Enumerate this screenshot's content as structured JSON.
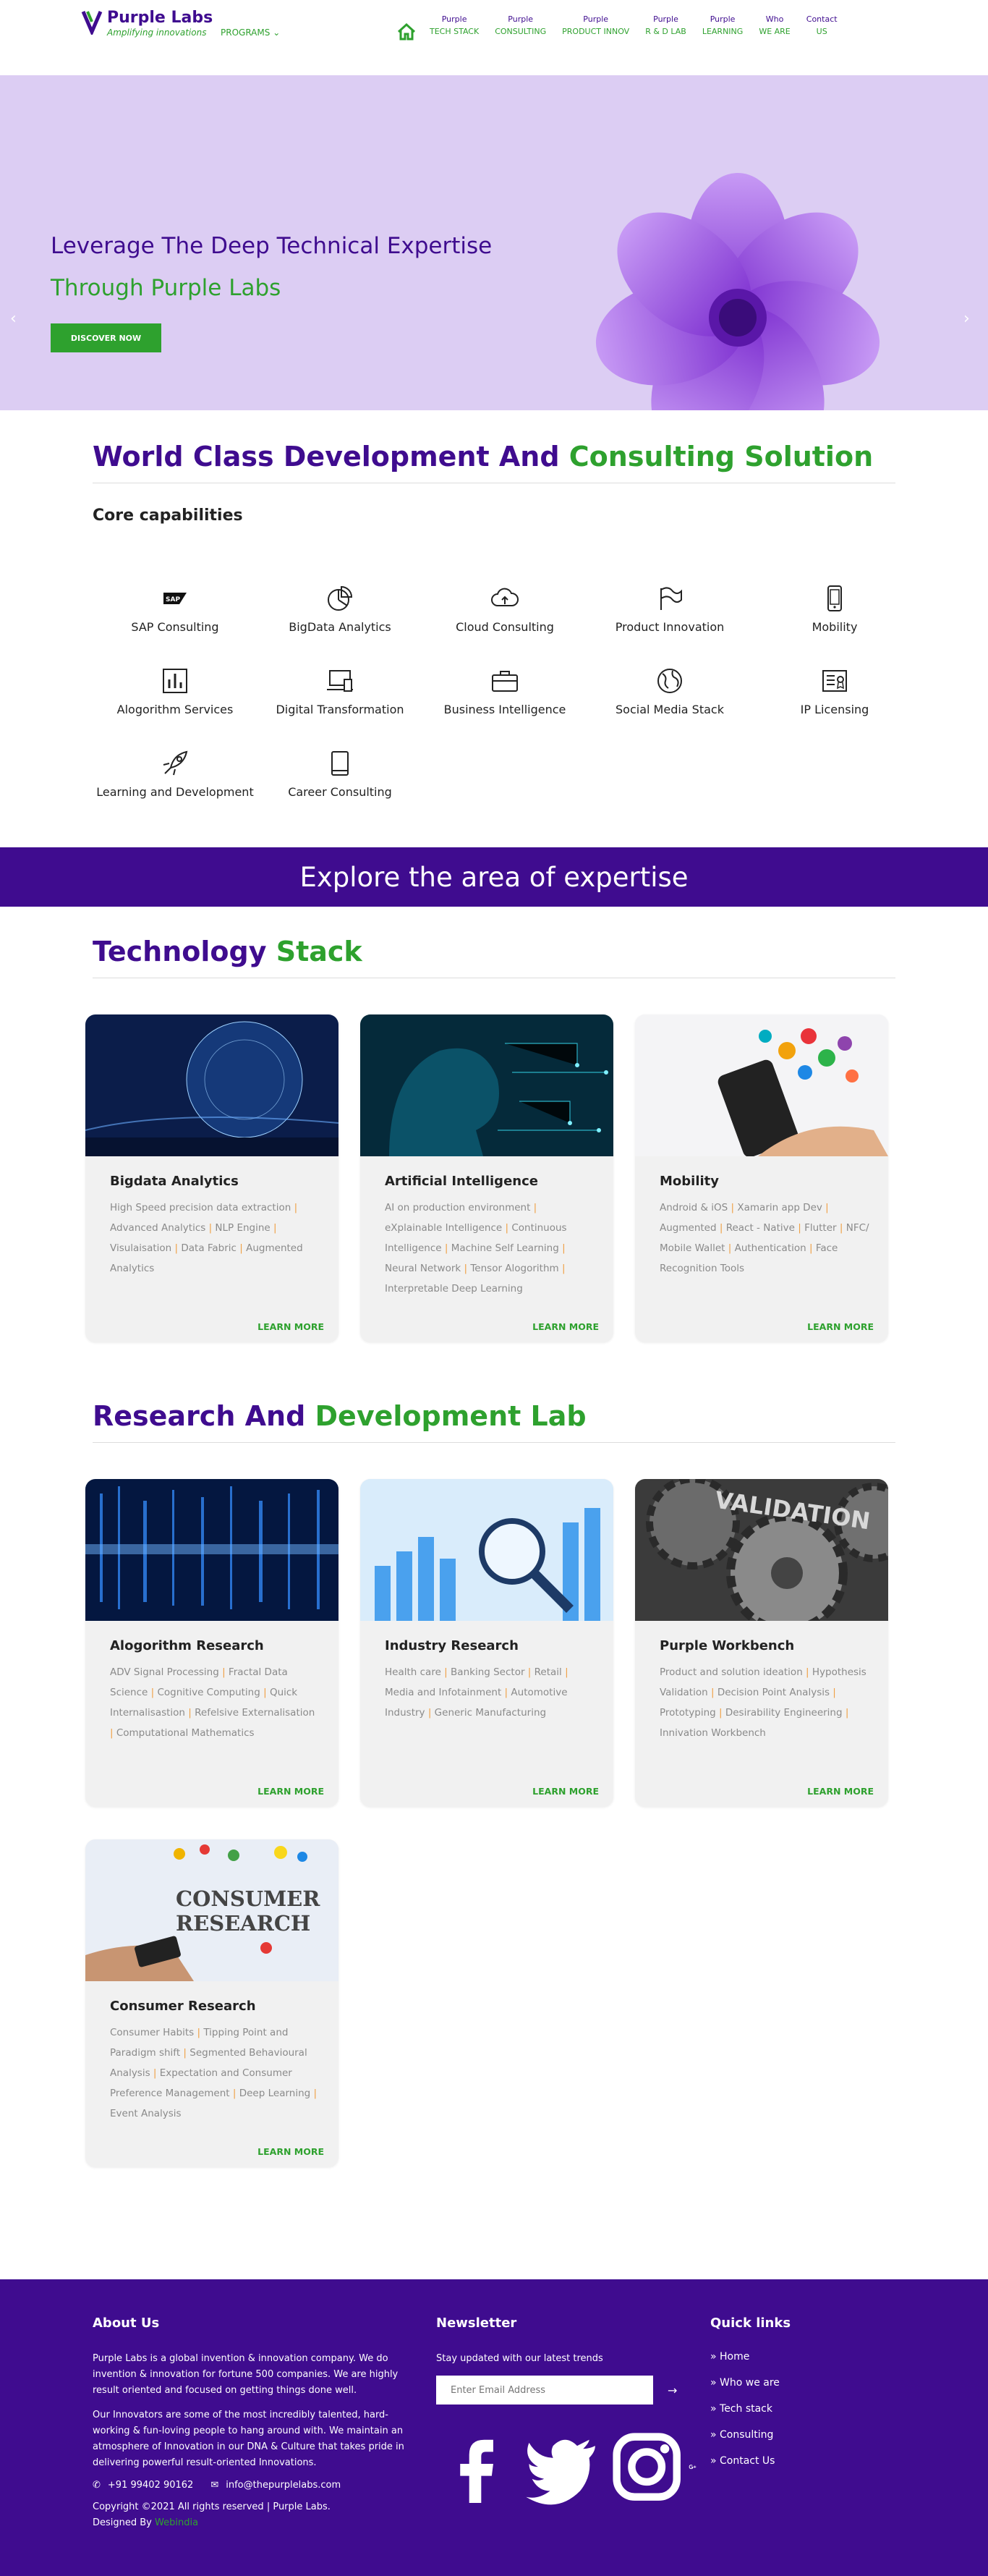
{
  "brand": {
    "name": "Purple Labs",
    "tagline": "Amplifying innovations"
  },
  "programs_label": "PROGRAMS",
  "nav": [
    {
      "top": "Purple",
      "bottom": "TECH STACK"
    },
    {
      "top": "Purple",
      "bottom": "CONSULTING"
    },
    {
      "top": "Purple",
      "bottom": "PRODUCT INNOV"
    },
    {
      "top": "Purple",
      "bottom": "R & D LAB"
    },
    {
      "top": "Purple",
      "bottom": "LEARNING"
    },
    {
      "top": "Who",
      "bottom": "WE ARE"
    },
    {
      "top": "Contact",
      "bottom": "US"
    }
  ],
  "hero": {
    "line1": "Leverage The Deep Technical Expertise",
    "line2": "Through Purple Labs",
    "button": "DISCOVER NOW"
  },
  "world": {
    "title_a": "World Class Development And",
    "title_b": "Consulting Solution",
    "core": "Core capabilities",
    "capabilities": [
      {
        "label": "SAP Consulting",
        "icon": "sap-icon"
      },
      {
        "label": "BigData Analytics",
        "icon": "pie-chart-icon"
      },
      {
        "label": "Cloud Consulting",
        "icon": "cloud-icon"
      },
      {
        "label": "Product Innovation",
        "icon": "flag-icon"
      },
      {
        "label": "Mobility",
        "icon": "mobile-icon"
      },
      {
        "label": "Alogorithm Services",
        "icon": "bar-chart-icon"
      },
      {
        "label": "Digital Transformation",
        "icon": "devices-icon"
      },
      {
        "label": "Business Intelligence",
        "icon": "briefcase-icon"
      },
      {
        "label": "Social Media Stack",
        "icon": "globe-icon"
      },
      {
        "label": "IP Licensing",
        "icon": "license-icon"
      },
      {
        "label": "Learning and Development",
        "icon": "rocket-icon"
      },
      {
        "label": "Career Consulting",
        "icon": "book-icon"
      }
    ]
  },
  "explore": "Explore the area of expertise",
  "tech": {
    "title_a": "Technology",
    "title_b": "Stack",
    "cards": [
      {
        "title": "Bigdata Analytics",
        "items": [
          "High Speed precision data extraction",
          "Advanced Analytics",
          "NLP Engine",
          "Visulaisation",
          "Data Fabric",
          "Augmented Analytics"
        ]
      },
      {
        "title": "Artificial Intelligence",
        "items": [
          "AI on production environment",
          "eXplainable Intelligence",
          "Continuous Intelligence",
          "Machine Self Learning",
          "Neural Network",
          "Tensor Alogorithm",
          "Interpretable Deep Learning"
        ]
      },
      {
        "title": "Mobility",
        "items": [
          "Android & iOS",
          "Xamarin app Dev",
          "Augmented",
          "React - Native",
          "Flutter",
          "NFC/ Mobile Wallet",
          "Authentication",
          "Face Recognition Tools"
        ]
      }
    ]
  },
  "rnd": {
    "title_a": "Research And",
    "title_b": "Development Lab",
    "cards": [
      {
        "title": "Alogorithm Research",
        "items": [
          "ADV Signal Processing",
          "Fractal Data Science",
          "Cognitive Computing",
          "Quick Internalisastion",
          "Refelsive Externalisation",
          "Computational Mathematics"
        ]
      },
      {
        "title": "Industry Research",
        "items": [
          "Health care",
          "Banking Sector",
          "Retail",
          "Media and Infotainment",
          "Automotive Industry",
          "Generic Manufacturing"
        ]
      },
      {
        "title": "Purple Workbench",
        "items": [
          "Product and solution ideation",
          "Hypothesis Validation",
          "Decision Point Analysis",
          "Prototyping",
          "Desirability Engineering",
          "Innivation Workbench"
        ]
      },
      {
        "title": "Consumer Research",
        "items": [
          "Consumer Habits",
          "Tipping Point and Paradigm shift",
          "Segmented Behavioural Analysis",
          "Expectation and Consumer Preference Management",
          "Deep Learning",
          "Event Analysis"
        ]
      }
    ],
    "img_text_validation": "VALIDATION",
    "img_text_consumer": "CONSUMER",
    "img_text_research": "RESEARCH"
  },
  "learn_more": "LEARN MORE",
  "footer": {
    "about_h": "About Us",
    "about_p1": "Purple Labs is a global invention & innovation company. We do invention & innovation for fortune 500 companies. We are highly result oriented and focused on getting things done well.",
    "about_p2": "Our Innovators are some of the most incredibly talented, hard-working & fun-loving people to hang around with. We maintain an atmosphere of Innovation in our DNA & Culture that takes pride in delivering powerful result-oriented Innovations.",
    "phone": "+91 99402 90162",
    "email": "info@thepurplelabs.com",
    "copyright": "Copyright ©2021 All rights reserved | Purple Labs.",
    "designed_by": "Designed By",
    "designer": "Webindia",
    "news_h": "Newsletter",
    "news_p": "Stay updated with our latest trends",
    "email_placeholder": "Enter Email Address",
    "links_h": "Quick links",
    "links": [
      "Home",
      "Who we are",
      "Tech stack",
      "Consulting",
      "Contact Us"
    ]
  }
}
